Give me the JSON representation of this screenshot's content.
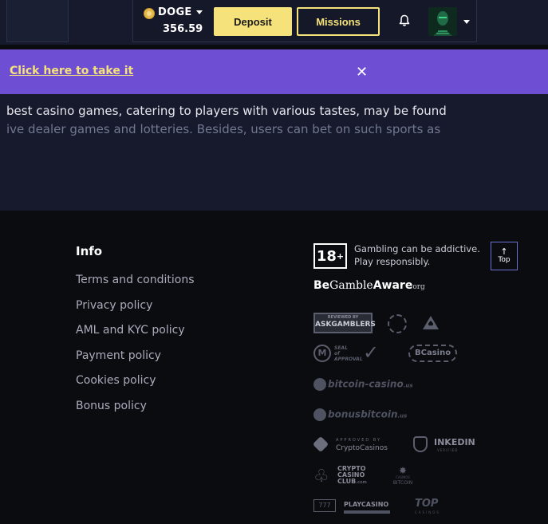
{
  "header": {
    "currency": "DOGE",
    "balance": "356.59",
    "deposit_label": "Deposit",
    "missions_label": "Missions",
    "coin_color": "#e5b84b",
    "accent_yellow": "#f6e27a"
  },
  "promo": {
    "link_text": "Click here to take it",
    "close_glyph": "✕",
    "bg_color": "#6e4fd4"
  },
  "description": {
    "line1": "best casino games, catering to players with various tastes, may be found",
    "line2": "ive dealer games and lotteries. Besides, users can bet on such sports as"
  },
  "footer": {
    "info_title": "Info",
    "links": [
      "Terms and conditions",
      "Privacy policy",
      "AML and KYC policy",
      "Payment policy",
      "Cookies policy",
      "Bonus policy"
    ],
    "age_badge": "18",
    "age_plus": "+",
    "gambling_line1": "Gambling can be addictive.",
    "gambling_line2": "Play responsibly.",
    "top_label": "Top",
    "bga_be": "Be",
    "bga_gamble": "Gamble",
    "bga_aware": "Aware",
    "bga_org": "org",
    "logos": {
      "askgamblers_top": "REVIEWED BY",
      "askgamblers": "ASKGAMBLERS",
      "seal1": "SEAL",
      "seal2": "of",
      "seal3": "APPROVAL",
      "bcasino": "BCasino",
      "bitcoin_casino": "bitcoin-casino",
      "bitcoin_casino_tld": ".us",
      "bonusbitcoin": "bonusbitcoin",
      "bonusbitcoin_tld": ".us",
      "crypto_approved": "APPROVED BY",
      "crypto_casinos": "CryptoCasinos",
      "inkedin": "INKEDIN",
      "inkedin_sub": "VERIFIED",
      "ccc_line1": "CRYPTO",
      "ccc_line2": "CASINO",
      "ccc_line3": "CLUB",
      "ccc_tld": ".com",
      "cs_bitcoin1": "CASINOS",
      "cs_bitcoin2": "BITCOIN",
      "playcasino": "PLAYCASINO",
      "top_casinos": "TOP",
      "top_casinos_sub": "CASINOS"
    }
  }
}
